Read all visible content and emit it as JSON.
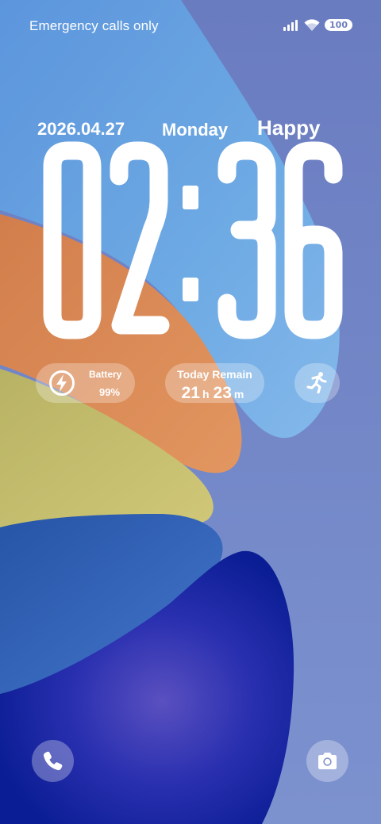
{
  "status_bar": {
    "carrier_text": "Emergency calls only",
    "battery_level": "100",
    "icons": [
      "signal-icon",
      "wifi-icon",
      "battery-icon"
    ]
  },
  "lockscreen": {
    "date": "2026.04.27",
    "weekday": "Monday",
    "greeting": "Happy",
    "time_hours": "02",
    "time_minutes": "36"
  },
  "widgets": {
    "battery": {
      "icon": "charging-bolt-icon",
      "label": "Battery",
      "value": "99%"
    },
    "today_remain": {
      "label": "Today Remain",
      "hours": "21",
      "hours_unit": "h",
      "minutes": "23",
      "minutes_unit": "m"
    },
    "activity": {
      "icon": "running-person-icon"
    }
  },
  "shortcuts": {
    "left": "phone-icon",
    "right": "camera-icon"
  },
  "colors": {
    "background": "#7183c4",
    "text": "#ffffff",
    "wave_light_blue": "#6fa5e0",
    "wave_orange": "#d48a58",
    "wave_yellow": "#c6bf6c",
    "wave_mid_blue": "#2d58a8",
    "wave_deep_blue": "#1428a0"
  }
}
